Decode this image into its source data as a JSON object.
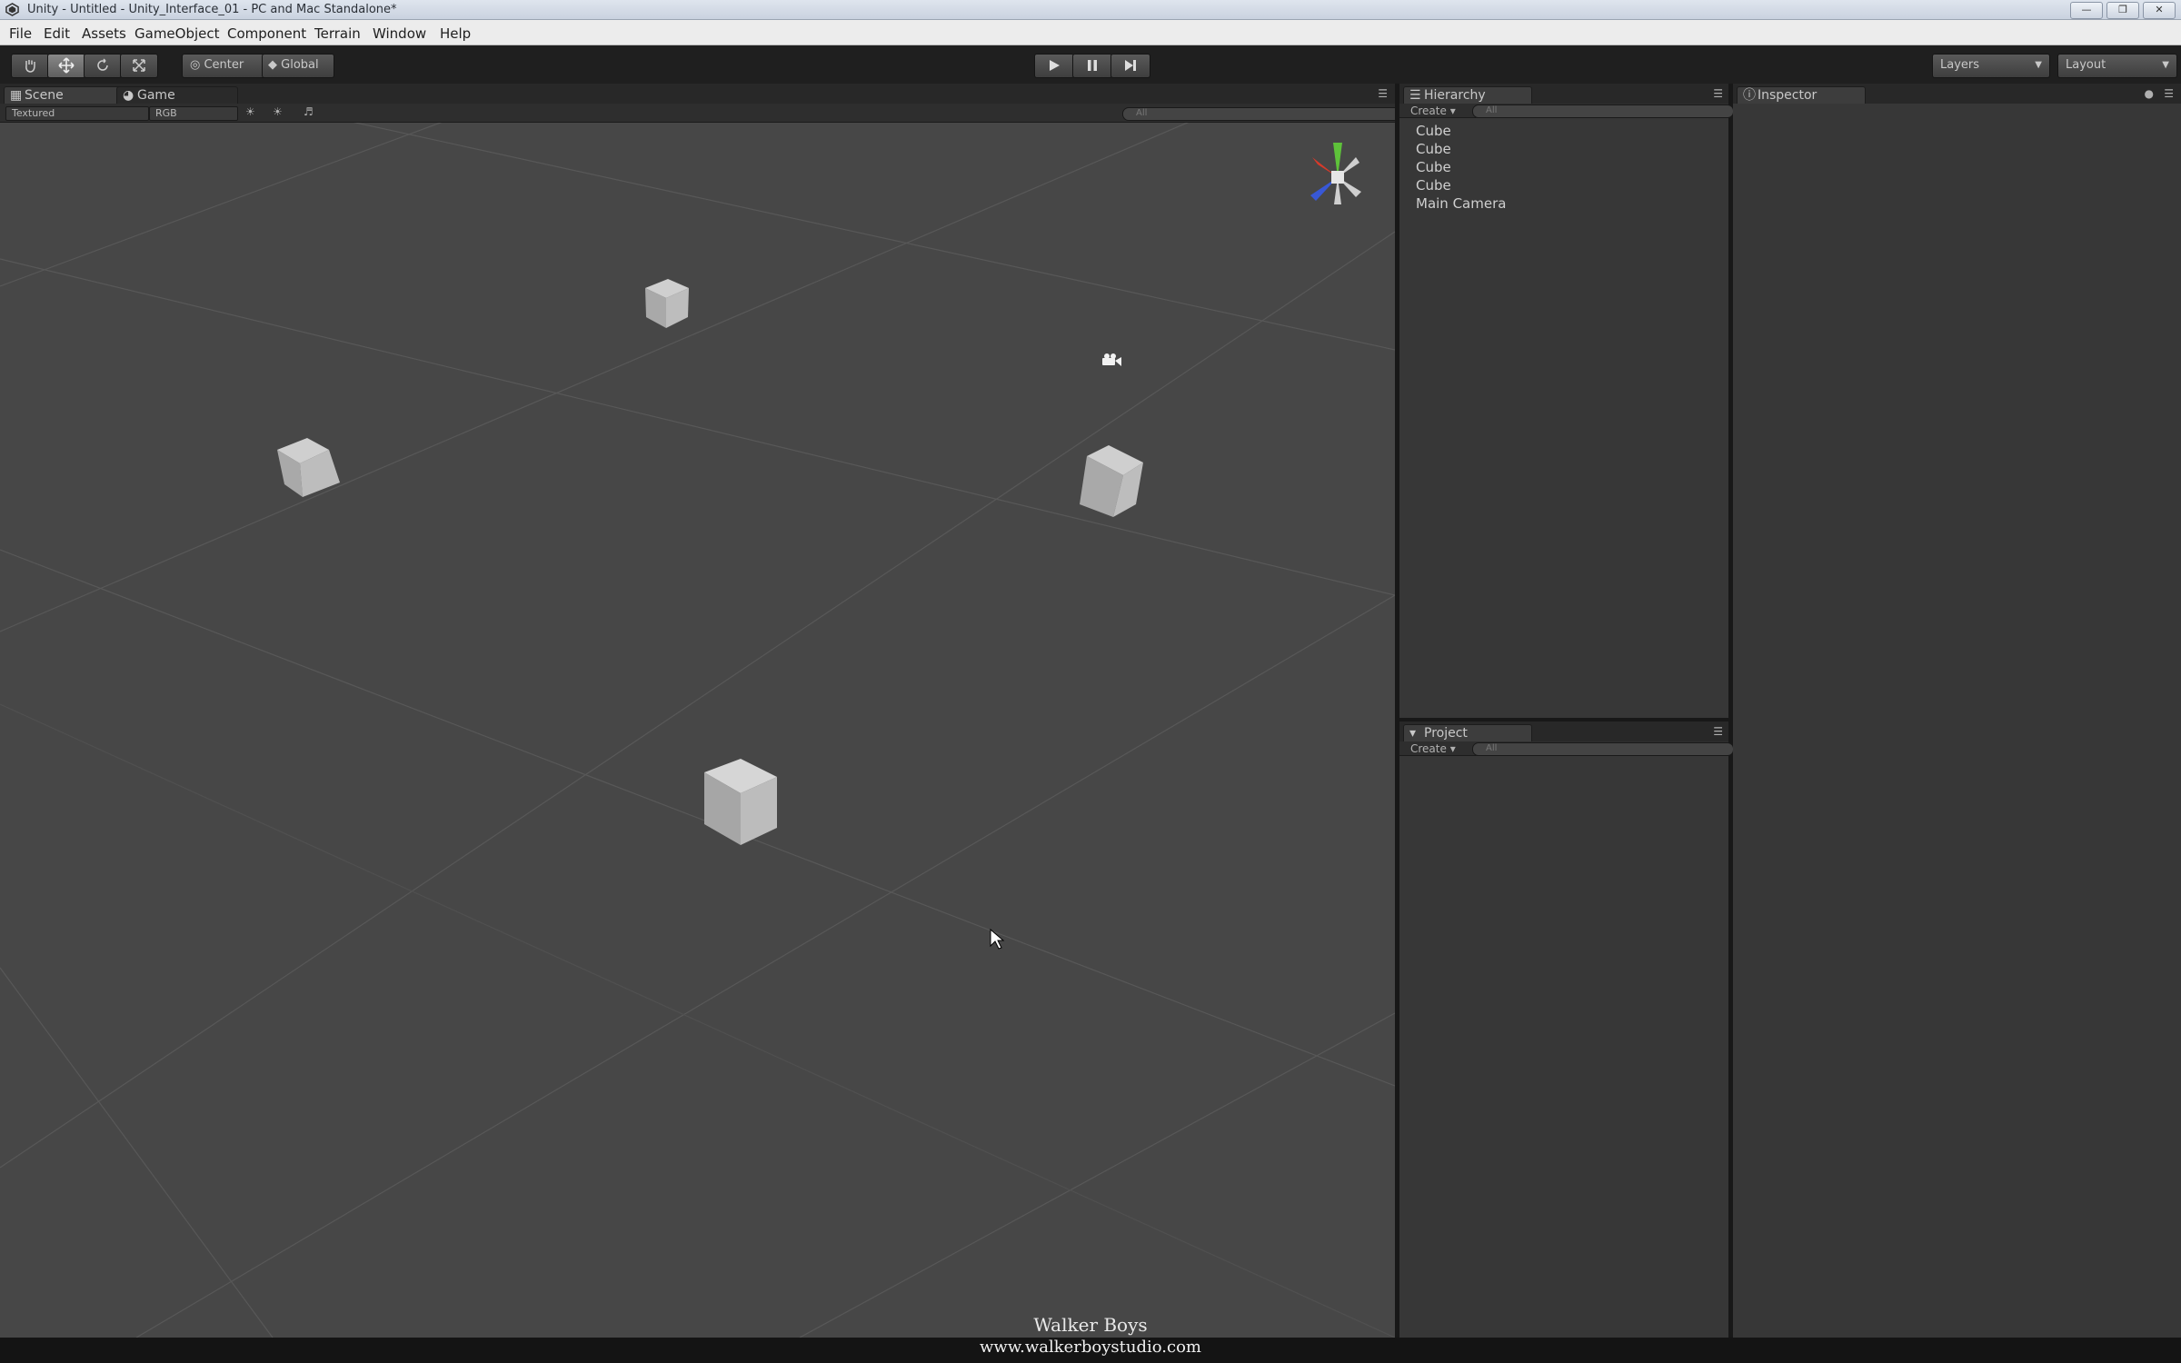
{
  "window": {
    "title": "Unity - Untitled - Unity_Interface_01 - PC and Mac Standalone*"
  },
  "menubar": {
    "items": [
      "File",
      "Edit",
      "Assets",
      "GameObject",
      "Component",
      "Terrain",
      "Window",
      "Help"
    ]
  },
  "toolbar": {
    "pivot_label": "Center",
    "space_label": "Global",
    "layers_label": "Layers",
    "layout_label": "Layout",
    "tools": [
      "hand-tool",
      "move-tool",
      "rotate-tool",
      "scale-tool"
    ],
    "play_controls": [
      "play",
      "pause",
      "step"
    ]
  },
  "scene_panel": {
    "tabs": [
      "Scene",
      "Game"
    ],
    "render_mode": "Textured",
    "color_mode": "RGB",
    "search_placeholder": "All"
  },
  "hierarchy": {
    "tab": "Hierarchy",
    "create_label": "Create",
    "search_placeholder": "All",
    "items": [
      "Cube",
      "Cube",
      "Cube",
      "Cube",
      "Main Camera"
    ]
  },
  "project": {
    "tab": "Project",
    "create_label": "Create",
    "search_placeholder": "All"
  },
  "inspector": {
    "tab": "Inspector"
  },
  "watermark": {
    "line1": "Walker Boys",
    "line2": "www.walkerboystudio.com"
  },
  "colors": {
    "scene_bg": "#474747",
    "panel_bg": "#373737",
    "toolbar_bg": "#1f1f1f"
  }
}
